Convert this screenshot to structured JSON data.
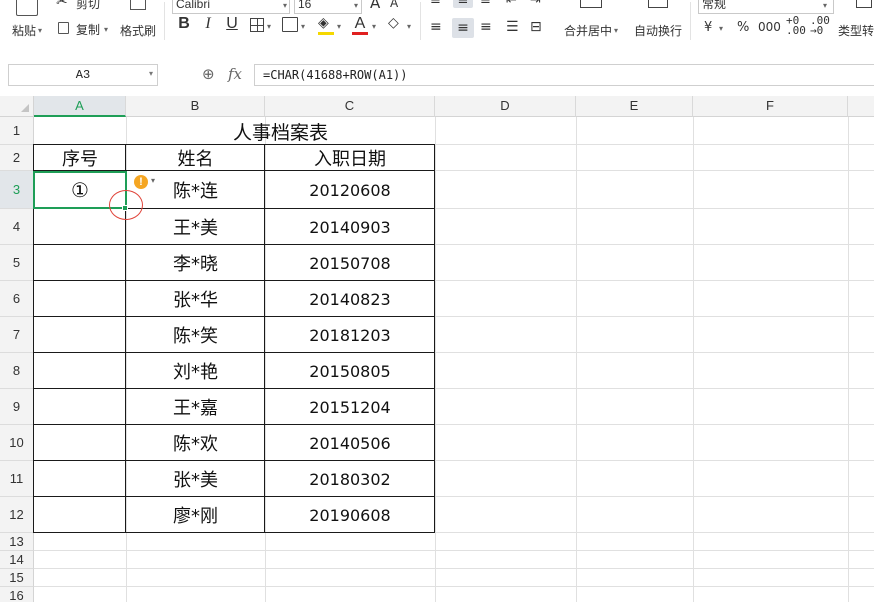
{
  "toolbar": {
    "cut_label": "剪切",
    "paste_label": "粘贴",
    "copy_label": "复制",
    "format_painter_label": "格式刷",
    "font_name": "Calibri",
    "font_size": "16",
    "font_grow_label": "A",
    "font_shrink_label": "A",
    "bold_label": "B",
    "italic_label": "I",
    "underline_label": "U",
    "font_color_label": "A",
    "merge_center_label": "合并居中",
    "wrap_text_label": "自动换行",
    "number_format": "常规",
    "currency_label": "¥",
    "percent_label": "%",
    "type_convert_label": "类型转"
  },
  "formula_bar": {
    "name_box": "A3",
    "fx_label": "fx",
    "formula": "=CHAR(41688+ROW(A1))"
  },
  "columns": [
    {
      "label": "A"
    },
    {
      "label": "B"
    },
    {
      "label": "C"
    },
    {
      "label": "D"
    },
    {
      "label": "E"
    },
    {
      "label": "F"
    }
  ],
  "rows": [
    "1",
    "2",
    "3",
    "4",
    "5",
    "6",
    "7",
    "8",
    "9",
    "10",
    "11",
    "12",
    "13",
    "14",
    "15",
    "16"
  ],
  "selected_cell": "A3",
  "table": {
    "title": "人事档案表",
    "headers": [
      "序号",
      "姓名",
      "入职日期"
    ],
    "records": [
      {
        "seq": "①",
        "name": "陈*连",
        "date": "20120608"
      },
      {
        "seq": "",
        "name": "王*美",
        "date": "20140903"
      },
      {
        "seq": "",
        "name": "李*晓",
        "date": "20150708"
      },
      {
        "seq": "",
        "name": "张*华",
        "date": "20140823"
      },
      {
        "seq": "",
        "name": "陈*笑",
        "date": "20181203"
      },
      {
        "seq": "",
        "name": "刘*艳",
        "date": "20150805"
      },
      {
        "seq": "",
        "name": "王*嘉",
        "date": "20151204"
      },
      {
        "seq": "",
        "name": "陈*欢",
        "date": "20140506"
      },
      {
        "seq": "",
        "name": "张*美",
        "date": "20180302"
      },
      {
        "seq": "",
        "name": "廖*刚",
        "date": "20190608"
      }
    ]
  },
  "error_indicator": "!",
  "colors": {
    "selection": "#1e9e57",
    "warning": "#f5a623",
    "annotation": "#e0443a"
  }
}
